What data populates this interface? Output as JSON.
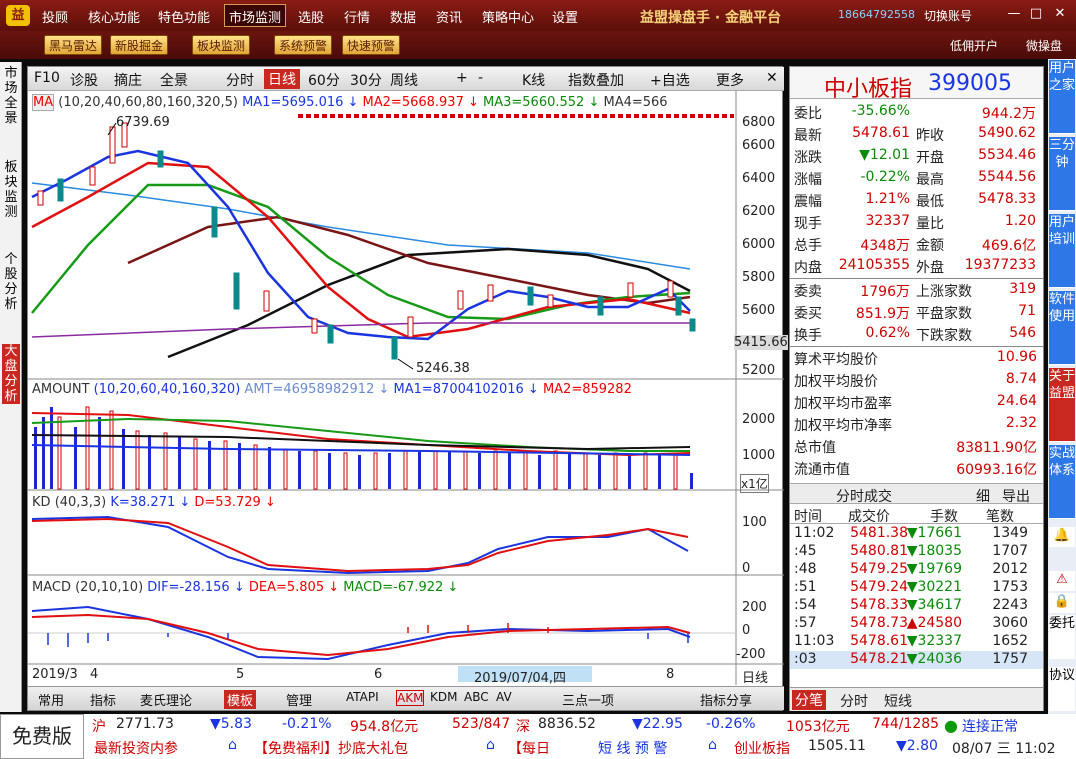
{
  "topbar": {
    "menus": [
      "投顾",
      "核心功能",
      "特色功能",
      "市场监测",
      "选股",
      "行情",
      "数据",
      "资讯",
      "策略中心",
      "设置"
    ],
    "active": "市场监测",
    "brand": "益盟操盘手 · 金融平台",
    "phone": "18664792558",
    "switch": "切换账号"
  },
  "toolbar": {
    "buttons": [
      "黑马雷达",
      "新股掘金",
      "板块监测",
      "系统预警",
      "快速预警"
    ],
    "right": [
      "低佣开户",
      "微操盘"
    ]
  },
  "leftnav": [
    "市场全景",
    "板块监测",
    "个股分析",
    "大盘分析"
  ],
  "rightnav": [
    "用户之家",
    "三分钟",
    "用户培训",
    "软件使用",
    "关于益盟",
    "实战体系",
    "委托",
    "协议"
  ],
  "chart_tabs": [
    "F10",
    "诊股",
    "摘庄",
    "全景",
    "分时",
    "日线",
    "60分",
    "30分",
    "周线",
    "+",
    "-",
    "K线",
    "指数叠加",
    "+自选",
    "更多",
    "✕"
  ],
  "main": {
    "ma_label": "MA",
    "ma_params": "(10,20,40,60,80,160,320,5)",
    "ma1": "MA1=5695.016 ↓",
    "ma2": "MA2=5668.937 ↓",
    "ma3": "MA3=5660.552 ↓",
    "ma4": "MA4=566",
    "high_label": "6739.69",
    "low_label": "5246.38",
    "y_ticks": [
      "6800",
      "6600",
      "6400",
      "6200",
      "6000",
      "5800",
      "5600",
      "5415.66",
      "5200"
    ]
  },
  "amount": {
    "label": "AMOUNT",
    "params": "(10,20,60,40,160,320)",
    "amt": "AMT=46958982912 ↓",
    "ma1": "MA1=87004102016 ↓",
    "ma2": "MA2=859282",
    "y_ticks": [
      "2000",
      "1000"
    ],
    "unit": "x1亿"
  },
  "kd": {
    "label": "KD",
    "params": "(40,3,3)",
    "k": "K=38.271 ↓",
    "d": "D=53.729 ↓",
    "y_ticks": [
      "100",
      "0"
    ]
  },
  "macd": {
    "label": "MACD",
    "params": "(20,10,10)",
    "dif": "DIF=-28.156 ↓",
    "dea": "DEA=5.805 ↓",
    "macd": "MACD=-67.922 ↓",
    "y_ticks": [
      "200",
      "0",
      "-200"
    ]
  },
  "xaxis": {
    "labels": [
      "2019/3",
      "4",
      "5",
      "6",
      "2019/07/04,四",
      "8"
    ],
    "right": "日线"
  },
  "bottom_tabs": [
    "常用",
    "指标",
    "麦氏理论",
    "模板",
    "管理",
    "ATAPI",
    "AKM",
    "KDM",
    "ABC",
    "AV",
    "三点一项",
    "指标分享"
  ],
  "quote": {
    "name": "中小板指",
    "code": "399005",
    "rows": [
      [
        "委比",
        "-35.66%",
        "",
        "944.2万"
      ],
      [
        "最新",
        "5478.61",
        "昨收",
        "5490.62"
      ],
      [
        "涨跌",
        "▼12.01",
        "开盘",
        "5534.46"
      ],
      [
        "涨幅",
        "-0.22%",
        "最高",
        "5544.56"
      ],
      [
        "震幅",
        "1.21%",
        "最低",
        "5478.33"
      ],
      [
        "现手",
        "32337",
        "量比",
        "1.20"
      ],
      [
        "总手",
        "4348万",
        "金额",
        "469.6亿"
      ],
      [
        "内盘",
        "24105355",
        "外盘",
        "19377233"
      ]
    ],
    "rows2": [
      [
        "委卖",
        "1796万",
        "上涨家数",
        "319"
      ],
      [
        "委买",
        "851.9万",
        "平盘家数",
        "71"
      ],
      [
        "换手",
        "0.62%",
        "下跌家数",
        "546"
      ]
    ],
    "stats": [
      [
        "算术平均股价",
        "10.96"
      ],
      [
        "加权平均股价",
        "8.74"
      ],
      [
        "加权平均市盈率",
        "24.64"
      ],
      [
        "加权平均市净率",
        "2.32"
      ],
      [
        "总市值",
        "83811.90亿"
      ],
      [
        "流通市值",
        "60993.16亿"
      ]
    ],
    "tick_title": "分时成交",
    "tick_btns": [
      "细",
      "导出"
    ],
    "tick_head": [
      "时间",
      "成交价",
      "手数",
      "笔数"
    ],
    "ticks": [
      [
        "11:02",
        "5481.38",
        "▼17661",
        "1349"
      ],
      [
        ":45",
        "5480.81",
        "▼18035",
        "1707"
      ],
      [
        ":48",
        "5479.25",
        "▼19769",
        "2012"
      ],
      [
        ":51",
        "5479.24",
        "▼30221",
        "1753"
      ],
      [
        ":54",
        "5478.33",
        "▼34617",
        "2243"
      ],
      [
        ":57",
        "5478.73",
        "▲24580",
        "3060"
      ],
      [
        "11:03",
        "5478.61",
        "▼32337",
        "1652"
      ],
      [
        ":03",
        "5478.21",
        "▼24036",
        "1757"
      ]
    ],
    "bottom": [
      "分笔",
      "分时",
      "短线"
    ]
  },
  "status": {
    "free": "免费版",
    "sh_name": "沪",
    "sh_price": "2771.73",
    "sh_chg": "▼5.83",
    "sh_pct": "-0.21%",
    "sh_amt": "954.8亿元",
    "sh_ud": "523/847",
    "sz_name": "深",
    "sz_price": "8836.52",
    "sz_chg": "▼22.95",
    "sz_pct": "-0.26%",
    "sz_amt": "1053亿元",
    "sz_ud": "744/1285",
    "conn": "连接正常",
    "news1": "最新投资内参",
    "news2": "【免费福利】抄底大礼包",
    "news3": "【每日",
    "warn": "短 线 预 警",
    "cy_name": "创业板指",
    "cy_price": "1505.11",
    "cy_chg": "▼2.80",
    "datetime": "08/07 三 11:02"
  }
}
